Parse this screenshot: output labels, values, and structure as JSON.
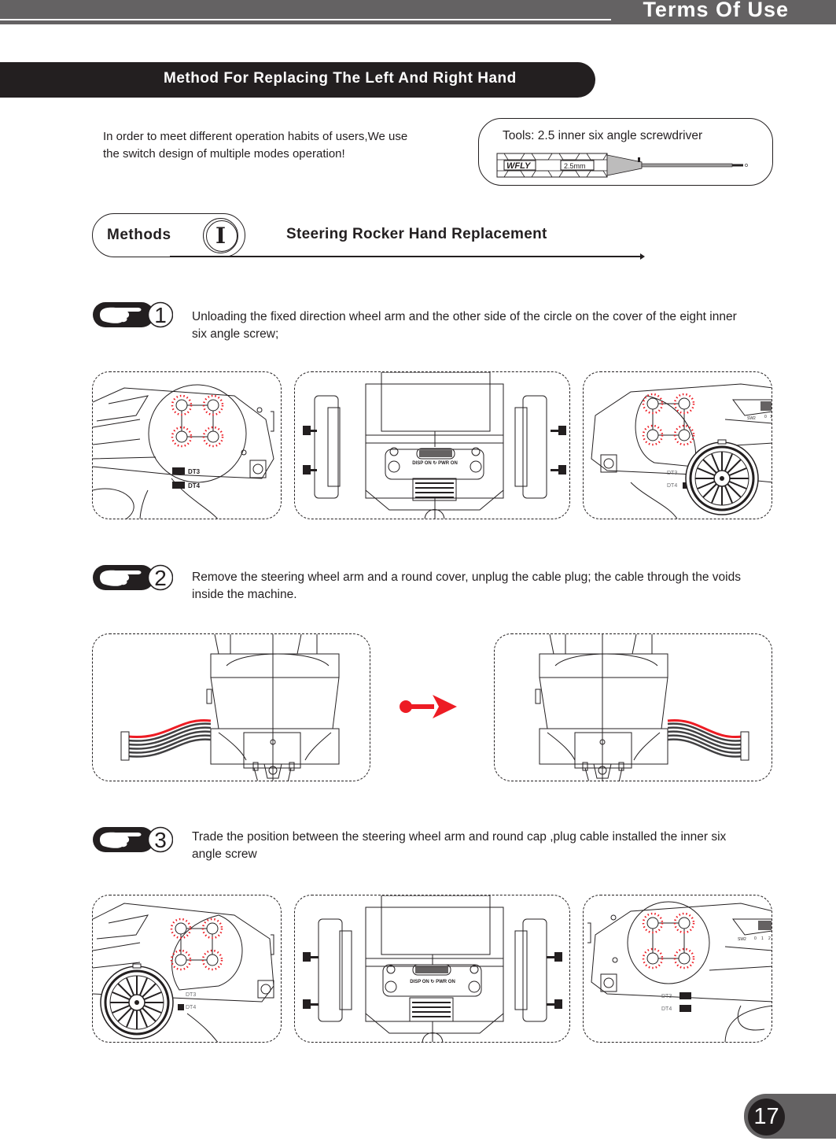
{
  "header": {
    "section_title": "Terms Of Use"
  },
  "banner": {
    "title": "Method For Replacing The Left And Right Hand"
  },
  "intro": {
    "text": "In order to meet different operation  habits of users,We use the switch design of multiple modes operation!"
  },
  "tools": {
    "label": "Tools: 2.5 inner six angle screwdriver",
    "screwdriver_brand": "WFLY",
    "screwdriver_size": "2.5mm"
  },
  "methods": {
    "label": "Methods",
    "number": "I",
    "heading": "Steering Rocker Hand Replacement"
  },
  "steps": [
    {
      "number": "1",
      "icon": "pointing-hand-icon",
      "text": "Unloading the fixed direction wheel arm and the other side of the circle on the cover of the eight inner six angle screw;"
    },
    {
      "number": "2",
      "icon": "pointing-hand-icon",
      "text": "Remove the steering wheel arm and a round cover, unplug the cable plug; the cable through the voids inside the machine."
    },
    {
      "number": "3",
      "icon": "pointing-hand-icon",
      "text": "Trade the position between the steering wheel arm and round cap ,plug cable installed the inner six angle screw"
    }
  ],
  "figure_labels": {
    "dt3": "DT3",
    "dt4": "DT4",
    "sw2": "SW2",
    "sw2_positions": [
      "0",
      "1",
      "2"
    ],
    "disp_pwr": "DISP ON ↻ PWR ON"
  },
  "colors": {
    "bar_gray": "#646263",
    "dark": "#231f20",
    "highlight_red": "#ed1c24"
  },
  "page": {
    "number": "17"
  }
}
